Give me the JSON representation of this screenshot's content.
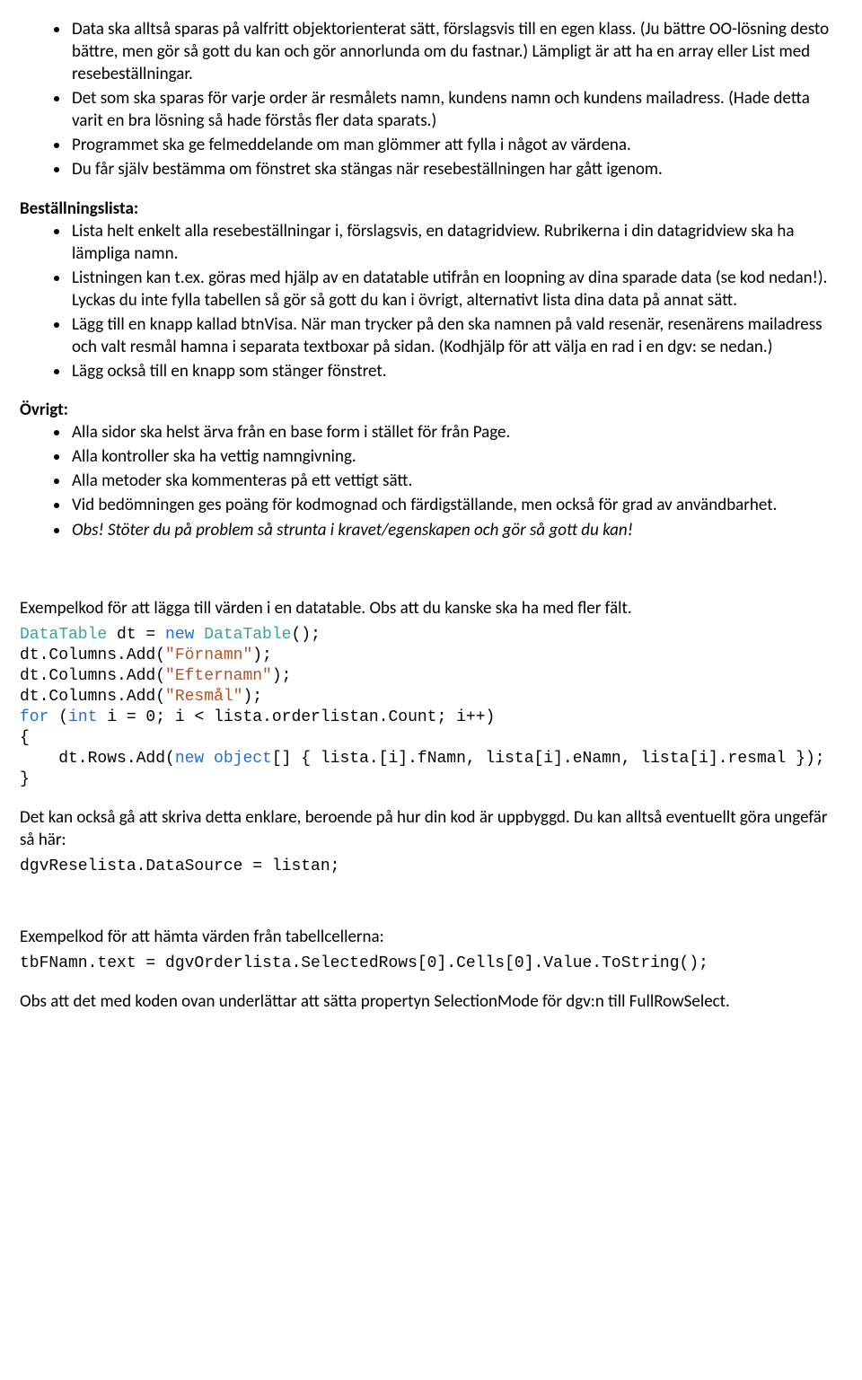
{
  "list1": [
    "Data ska alltså sparas på valfritt objektorienterat sätt, förslagsvis till en egen klass. (Ju bättre OO-lösning desto bättre, men gör så gott du kan och gör annorlunda om du fastnar.) Lämpligt är att ha en array eller List med resebeställningar.",
    "Det som ska sparas för varje order är resmålets namn, kundens namn och kundens mailadress. (Hade detta varit en bra lösning så hade förstås fler data sparats.)",
    "Programmet ska ge felmeddelande om man glömmer att fylla i något av värdena.",
    "Du får själv bestämma om fönstret ska stängas när resebeställningen har gått igenom."
  ],
  "h2": "Beställningslista:",
  "list2": [
    "Lista helt enkelt alla resebeställningar i, förslagsvis, en datagridview. Rubrikerna i din datagridview ska ha lämpliga namn.",
    "Listningen kan t.ex. göras med hjälp av en datatable utifrån en loopning av dina sparade data (se kod nedan!). Lyckas du inte fylla tabellen så gör så gott du kan i övrigt, alternativt lista dina data på annat sätt.",
    "Lägg till en knapp kallad btnVisa. När man trycker på den ska namnen på vald resenär, resenärens mailadress och valt resmål hamna i separata textboxar på sidan. (Kodhjälp för att välja en rad i en dgv: se nedan.)",
    "Lägg också till en knapp som stänger fönstret."
  ],
  "h3": "Övrigt:",
  "list3": [
    "Alla sidor ska helst ärva från en base form i stället för från Page.",
    "Alla kontroller ska ha vettig namngivning.",
    "Alla metoder ska kommenteras på ett vettigt sätt.",
    "Vid bedömningen ges poäng för kodmognad och färdigställande, men också för grad av användbarhet."
  ],
  "list3_italic": "Obs! Stöter du på problem så strunta i kravet/egenskapen och gör så gott du kan!",
  "p_ex1": "Exempelkod för att lägga till värden i en datatable. Obs att du kanske ska ha med fler fält.",
  "code1": {
    "t_DataTable": "DataTable",
    "t_new": "new",
    "t_DataTable2": "DataTable",
    "s_fornamn": "\"Förnamn\"",
    "s_efternamn": "\"Efternamn\"",
    "s_resmal": "\"Resmål\"",
    "t_for": "for",
    "t_int": "int",
    "t_object": "object",
    "line0_a": " dt = ",
    "line0_b": "();",
    "line1": "dt.Columns.Add(",
    "line1b": ");",
    "line4a": " (",
    "line4b": " i = 0; i < lista.orderlistan.Count; i++)",
    "brace_open": "{",
    "line5a": "    dt.Rows.Add(",
    "line5b": "[] { lista.[i].fNamn, lista[i].eNamn, lista[i].resmal });",
    "brace_close": "}"
  },
  "p_ex1b": "Det kan också gå att skriva detta enklare, beroende på hur din kod är uppbyggd. Du kan alltså eventuellt göra ungefär så här:",
  "code2": "dgvReselista.DataSource = listan;",
  "p_ex2": "Exempelkod för att hämta värden från tabellcellerna:",
  "code3": "tbFNamn.text = dgvOrderlista.SelectedRows[0].Cells[0].Value.ToString();",
  "p_end": "Obs att det med koden ovan underlättar att sätta propertyn SelectionMode för dgv:n till FullRowSelect."
}
